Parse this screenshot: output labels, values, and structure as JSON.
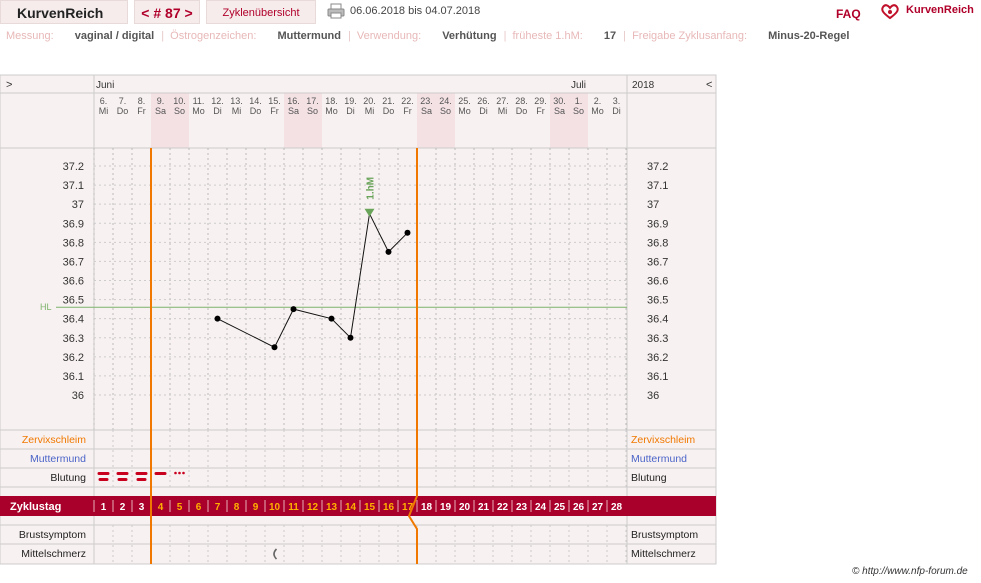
{
  "app": {
    "brand": "KurvenReich",
    "cycle_label": "< # 87 >",
    "overview_label": "Zyklenübersicht",
    "date_range": "06.06.2018 bis 04.07.2018",
    "faq": "FAQ",
    "logo_text": "KurvenReich"
  },
  "info": {
    "messung_label": "Messung:",
    "messung_value": "vaginal / digital",
    "oestrogen_label": "Östrogenzeichen:",
    "oestrogen_value": "Muttermund",
    "verwendung_label": "Verwendung:",
    "verwendung_value": "Verhütung",
    "hm_label": "früheste 1.hM:",
    "hm_value": "17",
    "freigabe_label": "Freigabe Zyklusanfang:",
    "freigabe_value": "Minus-20-Regel"
  },
  "footer": "© http://www.nfp-forum.de",
  "chart_data": {
    "type": "line",
    "left_toggle": ">",
    "right_toggle": "<",
    "year": "2018",
    "month_labels": [
      {
        "day_index": 0,
        "label": "Juni"
      },
      {
        "day_index": 25,
        "label": "Juli"
      }
    ],
    "dates": [
      "6.",
      "7.",
      "8.",
      "9.",
      "10.",
      "11.",
      "12.",
      "13.",
      "14.",
      "15.",
      "16.",
      "17.",
      "18.",
      "19.",
      "20.",
      "21.",
      "22.",
      "23.",
      "24.",
      "25.",
      "26.",
      "27.",
      "28.",
      "29.",
      "30.",
      "1.",
      "2.",
      "3."
    ],
    "weekdays": [
      "Mi",
      "Do",
      "Fr",
      "Sa",
      "So",
      "Mo",
      "Di",
      "Mi",
      "Do",
      "Fr",
      "Sa",
      "So",
      "Mo",
      "Di",
      "Mi",
      "Do",
      "Fr",
      "Sa",
      "So",
      "Mo",
      "Di",
      "Mi",
      "Do",
      "Fr",
      "Sa",
      "So",
      "Mo",
      "Di"
    ],
    "cycle_days": [
      1,
      2,
      3,
      4,
      5,
      6,
      7,
      8,
      9,
      10,
      11,
      12,
      13,
      14,
      15,
      16,
      17,
      18,
      19,
      20,
      21,
      22,
      23,
      24,
      25,
      26,
      27,
      28
    ],
    "cycle_row_label": "Zyklustag",
    "temperatures": [
      null,
      null,
      null,
      null,
      null,
      null,
      36.4,
      null,
      null,
      36.25,
      36.45,
      null,
      36.4,
      36.3,
      36.95,
      36.75,
      36.85,
      null,
      null,
      null,
      null,
      null,
      null,
      null,
      null,
      null,
      null,
      null
    ],
    "ylim": [
      36.0,
      37.2
    ],
    "yticks": [
      "37.2",
      "37.1",
      "37",
      "36.9",
      "36.8",
      "36.7",
      "36.6",
      "36.5",
      "36.4",
      "36.3",
      "36.2",
      "36.1",
      "36"
    ],
    "hl_value": 36.46,
    "hl_label": "HL",
    "hm_marker": {
      "day": 15,
      "label": "1.hM"
    },
    "orange_lines_after_day": [
      3,
      17
    ],
    "rows": {
      "zervix": "Zervixschleim",
      "muttermund": "Muttermund",
      "blutung": "Blutung",
      "brust": "Brustsymptom",
      "mittelschmerz": "Mittelschmerz"
    },
    "bleeding": [
      "strong",
      "strong",
      "strong",
      "medium",
      "spotting",
      null,
      null,
      null,
      null,
      null,
      null,
      null,
      null,
      null,
      null,
      null,
      null,
      null,
      null,
      null,
      null,
      null,
      null,
      null,
      null,
      null,
      null,
      null
    ],
    "mittelschmerz_day": 10,
    "colors": {
      "accent": "#a8002a",
      "orange": "#f07800",
      "hl_line": "#7cb36c",
      "weekend": "#f3e1e4",
      "panel": "#f8f1f1",
      "grid": "#c8c8c8"
    }
  }
}
